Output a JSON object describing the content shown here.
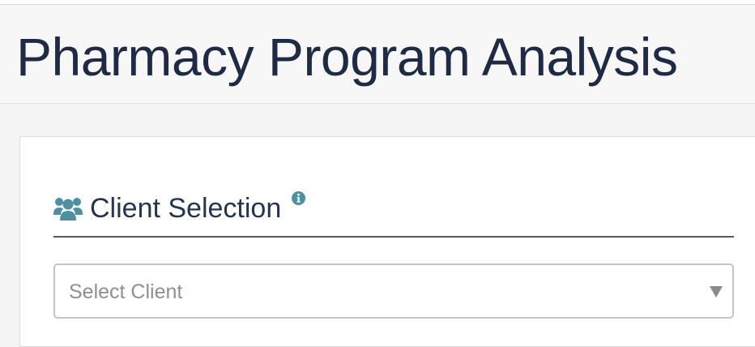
{
  "header": {
    "title": "Pharmacy Program Analysis"
  },
  "client_section": {
    "title": "Client Selection",
    "icon": "users-icon",
    "info_icon": "info-icon",
    "select": {
      "placeholder": "Select Client",
      "caret_icon": "caret-down-icon"
    }
  },
  "colors": {
    "title_text": "#1f2a44",
    "section_text": "#233550",
    "icon_accent": "#4e8fa0",
    "placeholder_text": "#8f8f8f",
    "page_background": "#f4f4f5",
    "card_background": "#ffffff"
  }
}
